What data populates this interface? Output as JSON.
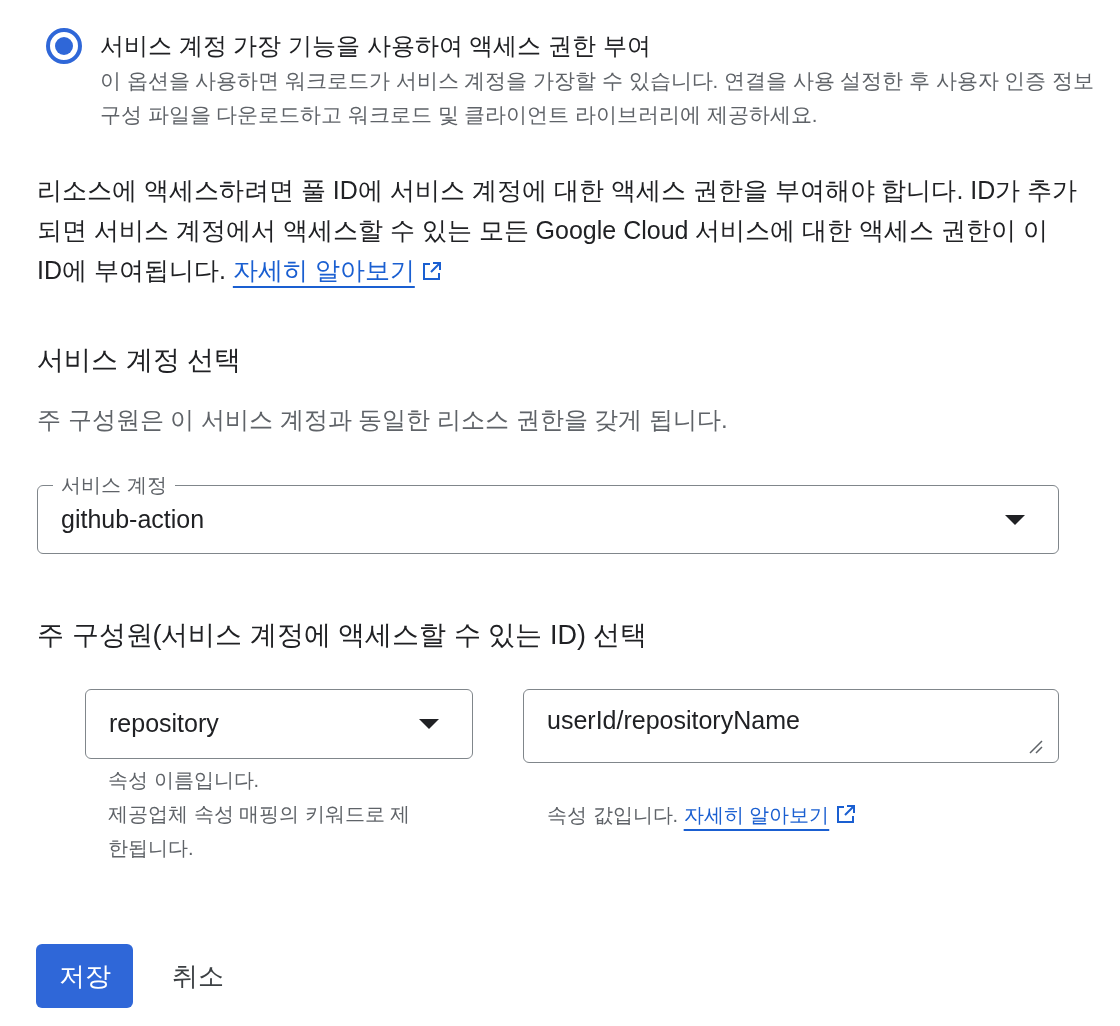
{
  "radio_option": {
    "selected": true,
    "label": "서비스 계정 가장 기능을 사용하여 액세스 권한 부여",
    "description": "이 옵션을 사용하면 워크로드가 서비스 계정을 가장할 수 있습니다. 연결을 사용 설정한 후 사용자 인증 정보 구성 파일을 다운로드하고 워크로드 및 클라이언트 라이브러리에 제공하세요."
  },
  "access_note": {
    "text": "리소스에 액세스하려면 풀 ID에 서비스 계정에 대한 액세스 권한을 부여해야 합니다. ID가 추가되면 서비스 계정에서 액세스할 수 있는 모든 Google Cloud 서비스에 대한 액세스 권한이 이 ID에 부여됩니다.",
    "link": "자세히 알아보기"
  },
  "service_account_section": {
    "heading": "서비스 계정 선택",
    "description": "주 구성원은 이 서비스 계정과 동일한 리소스 권한을 갖게 됩니다.",
    "select": {
      "label": "서비스 계정",
      "value": "github-action"
    }
  },
  "principal_section": {
    "heading": "주 구성원(서비스 계정에 액세스할 수 있는 ID) 선택",
    "attribute_select": {
      "value": "repository",
      "helper": [
        "속성 이름입니다.",
        "제공업체 속성 매핑의 키워드로 제한됩니다."
      ]
    },
    "value_field": {
      "value": "userId/repositoryName",
      "helper": "속성 값입니다.",
      "link": "자세히 알아보기"
    }
  },
  "buttons": [
    {
      "label": "저장",
      "kind": "primary"
    },
    {
      "label": "취소",
      "kind": "text"
    }
  ]
}
